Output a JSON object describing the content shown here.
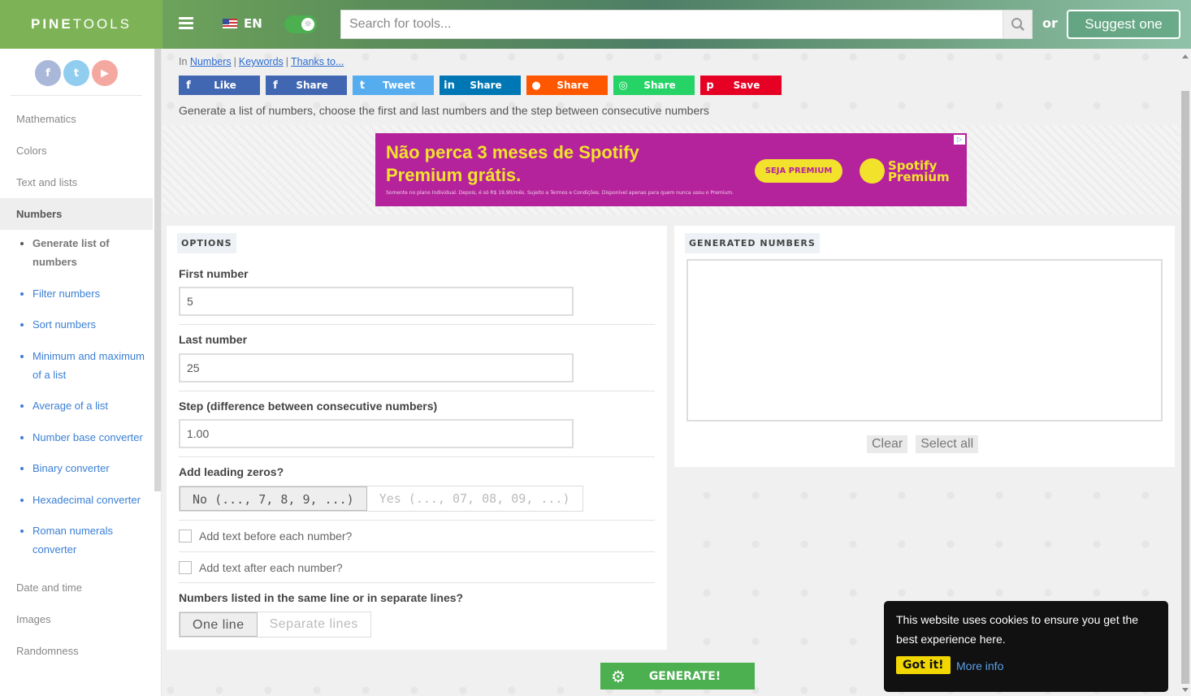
{
  "header": {
    "logo_bold": "PINE",
    "logo_light": "TOOLS",
    "language": "EN",
    "search_placeholder": "Search for tools...",
    "or_label": "or",
    "suggest_label": "Suggest one"
  },
  "sidebar": {
    "socials": [
      "f",
      "t",
      "▶"
    ],
    "categories_top": [
      "Mathematics",
      "Colors",
      "Text and lists",
      "Numbers"
    ],
    "active_category": "Numbers",
    "sub_items": [
      "Generate list of numbers",
      "Filter numbers",
      "Sort numbers",
      "Minimum and maximum of a list",
      "Average of a list",
      "Number base converter",
      "Binary converter",
      "Hexadecimal converter",
      "Roman numerals converter"
    ],
    "categories_bottom": [
      "Date and time",
      "Images",
      "Randomness"
    ]
  },
  "breadcrumb": {
    "prefix": "In",
    "links": [
      "Numbers",
      "Keywords",
      "Thanks to..."
    ]
  },
  "share_buttons": [
    {
      "label": "Like",
      "icon": "facebook-icon",
      "glyph": "f",
      "color": "#4267b2"
    },
    {
      "label": "Share",
      "icon": "facebook-icon",
      "glyph": "f",
      "color": "#4267b2"
    },
    {
      "label": "Tweet",
      "icon": "twitter-icon",
      "glyph": "t",
      "color": "#55acee"
    },
    {
      "label": "Share",
      "icon": "linkedin-icon",
      "glyph": "in",
      "color": "#0077b5"
    },
    {
      "label": "Share",
      "icon": "reddit-icon",
      "glyph": "●",
      "color": "#ff5700"
    },
    {
      "label": "Share",
      "icon": "whatsapp-icon",
      "glyph": "◎",
      "color": "#25d366"
    },
    {
      "label": "Save",
      "icon": "pinterest-icon",
      "glyph": "p",
      "color": "#e60023"
    }
  ],
  "description": "Generate a list of numbers, choose the first and last numbers and the step between consecutive numbers",
  "ad": {
    "headline_line1": "Não perca 3 meses de Spotify",
    "headline_line2": "Premium grátis.",
    "fine_print": "Somente no plano Individual. Depois, é só R$ 19,90/mês. Sujeito a Termos e Condições. Disponível apenas para quem nunca usou o Premium.",
    "cta": "SEJA PREMIUM",
    "brand_line1": "Spotify",
    "brand_line2": "Premium",
    "adchoices": "▷"
  },
  "options": {
    "title": "OPTIONS",
    "first_label": "First number",
    "first_value": "5",
    "last_label": "Last number",
    "last_value": "25",
    "step_label": "Step (difference between consecutive numbers)",
    "step_value": "1.00",
    "zeros_label": "Add leading zeros?",
    "zeros_no": "No (..., 7, 8, 9, ...)",
    "zeros_yes": "Yes (..., 07, 08, 09, ...)",
    "text_before": "Add text before each number?",
    "text_after": "Add text after each number?",
    "lines_label": "Numbers listed in the same line or in separate lines?",
    "lines_one": "One line",
    "lines_separate": "Separate lines"
  },
  "output": {
    "title": "GENERATED NUMBERS",
    "clear": "Clear",
    "select_all": "Select all"
  },
  "generate_label": "GENERATE!",
  "cookie": {
    "message": "This website uses cookies to ensure you get the best experience here.",
    "accept": "Got it!",
    "more": "More info"
  }
}
